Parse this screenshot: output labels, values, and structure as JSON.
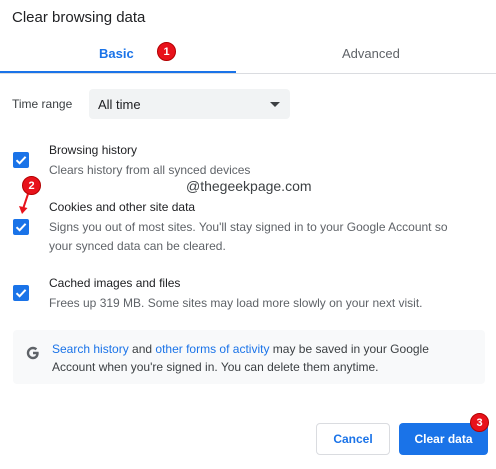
{
  "dialog": {
    "title": "Clear browsing data"
  },
  "tabs": [
    {
      "label": "Basic",
      "selected": true
    },
    {
      "label": "Advanced",
      "selected": false
    }
  ],
  "time_range": {
    "label": "Time range",
    "value": "All time"
  },
  "options": [
    {
      "title": "Browsing history",
      "description": "Clears history from all synced devices",
      "checked": true
    },
    {
      "title": "Cookies and other site data",
      "description_line1": "Signs you out of most sites. You'll stay signed in to your Google Account so",
      "description_line2": "your synced data can be cleared.",
      "checked": true
    },
    {
      "title": "Cached images and files",
      "description": "Frees up 319 MB. Some sites may load more slowly on your next visit.",
      "checked": true
    }
  ],
  "info": {
    "link1": "Search history",
    "text1": " and ",
    "link2": "other forms of activity",
    "text2": " may be saved in your Google Account when you're signed in. You can delete them anytime."
  },
  "buttons": {
    "cancel": "Cancel",
    "clear": "Clear data"
  },
  "annotations": {
    "watermark": "@thegeekpage.com",
    "marker1": "1",
    "marker2": "2",
    "marker3": "3"
  },
  "colors": {
    "accent": "#1a73e8",
    "marker": "#e8121b"
  }
}
